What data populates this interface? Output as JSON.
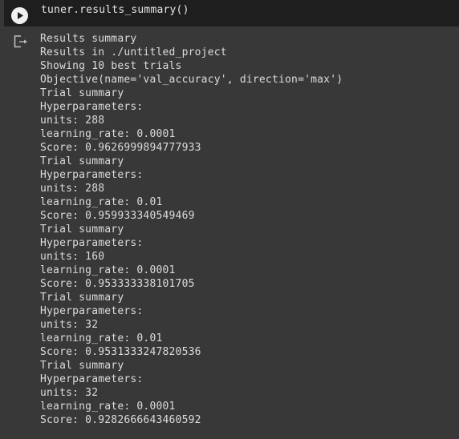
{
  "cell": {
    "code": "tuner.results_summary()",
    "run_button_label": "Run cell"
  },
  "output": {
    "lines": [
      "Results summary",
      "Results in ./untitled_project",
      "Showing 10 best trials",
      "Objective(name='val_accuracy', direction='max')",
      "Trial summary",
      "Hyperparameters:",
      "units: 288",
      "learning_rate: 0.0001",
      "Score: 0.9626999894777933",
      "Trial summary",
      "Hyperparameters:",
      "units: 288",
      "learning_rate: 0.01",
      "Score: 0.959933340549469",
      "Trial summary",
      "Hyperparameters:",
      "units: 160",
      "learning_rate: 0.0001",
      "Score: 0.953333338101705",
      "Trial summary",
      "Hyperparameters:",
      "units: 32",
      "learning_rate: 0.01",
      "Score: 0.9531333247820536",
      "Trial summary",
      "Hyperparameters:",
      "units: 32",
      "learning_rate: 0.0001",
      "Score: 0.9282666643460592"
    ]
  },
  "colors": {
    "cell_background": "#1e1e1e",
    "output_background": "#383838",
    "text": "#dcdcdc"
  }
}
